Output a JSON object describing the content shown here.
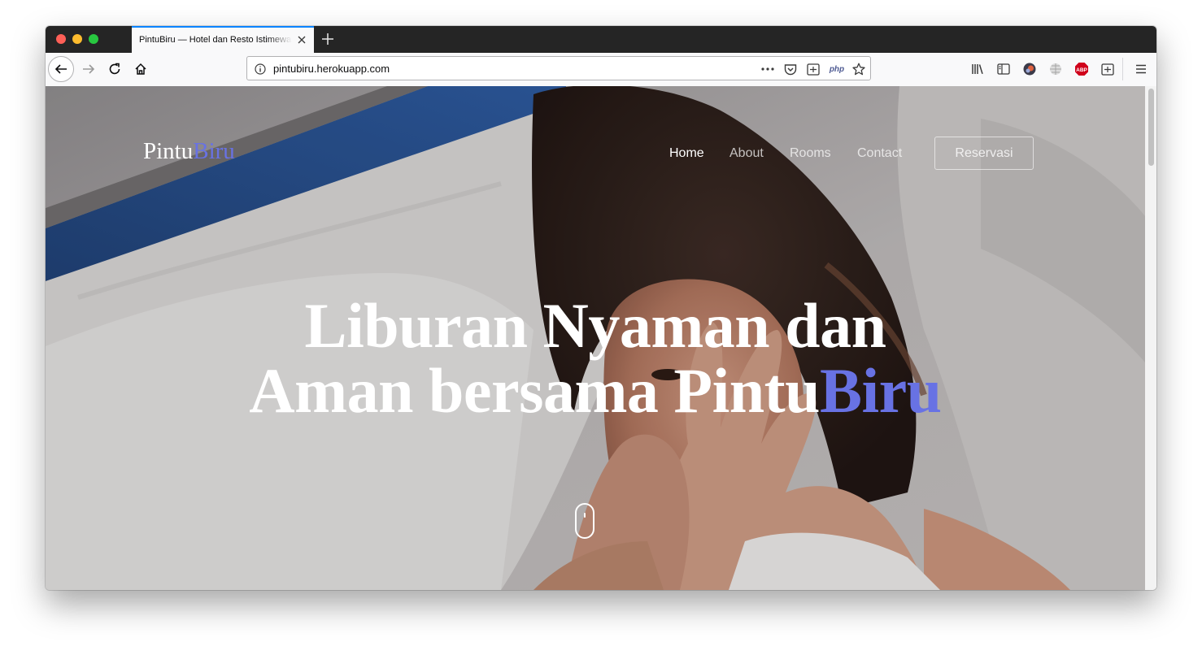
{
  "browser": {
    "tab_title": "PintuBiru — Hotel dan Resto Istimewa",
    "url": "pintubiru.herokuapp.com",
    "toolbar_icons": [
      "back-icon",
      "forward-icon",
      "reload-icon",
      "home-icon",
      "info-icon",
      "more-icon",
      "pocket-icon",
      "reader-icon",
      "php-icon",
      "bookmark-star-icon",
      "library-icon",
      "sidebar-icon",
      "avatar-icon",
      "globe-icon",
      "adblock-icon",
      "extension-icon",
      "menu-icon"
    ],
    "php_label": "php",
    "abp_label": "ABP"
  },
  "site": {
    "logo_part1": "Pintu",
    "logo_part2": "Biru",
    "nav": [
      {
        "label": "Home",
        "active": true
      },
      {
        "label": "About",
        "active": false
      },
      {
        "label": "Rooms",
        "active": false
      },
      {
        "label": "Contact",
        "active": false
      }
    ],
    "reserve_label": "Reservasi",
    "hero_line1": "Liburan Nyaman dan",
    "hero_line2_part1": "Aman bersama Pintu",
    "hero_line2_part2": "Biru",
    "scroll_indicator": "mouse-scroll-icon"
  },
  "colors": {
    "accent": "#6872e4",
    "tab_highlight": "#0a84ff",
    "tab_strip": "#252525"
  }
}
